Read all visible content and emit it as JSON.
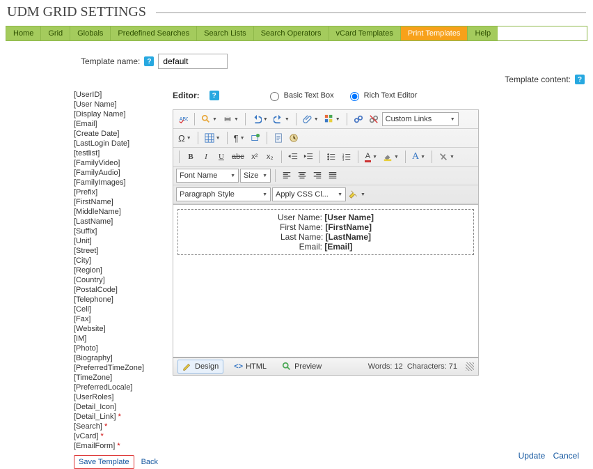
{
  "title": "UDM GRID SETTINGS",
  "tabs": [
    "Home",
    "Grid",
    "Globals",
    "Predefined Searches",
    "Search Lists",
    "Search Operators",
    "vCard Templates",
    "Print Templates",
    "Help"
  ],
  "active_tab": 7,
  "template_name_label": "Template name:",
  "template_name_value": "default",
  "template_content_label": "Template content:",
  "editor_label": "Editor:",
  "editor_modes": {
    "basic": "Basic Text Box",
    "rich": "Rich Text Editor"
  },
  "editor_mode_selected": "rich",
  "custom_links_label": "Custom Links",
  "font_name_label": "Font Name",
  "size_label": "Size",
  "paragraph_label": "Paragraph Style",
  "css_class_label": "Apply CSS Cl...",
  "fields": [
    "[UserID]",
    "[User Name]",
    "[Display Name]",
    "[Email]",
    "[Create Date]",
    "[LastLogin Date]",
    "[testlist]",
    "[FamilyVideo]",
    "[FamilyAudio]",
    "[FamilyImages]",
    "[Prefix]",
    "[FirstName]",
    "[MiddleName]",
    "[LastName]",
    "[Suffix]",
    "[Unit]",
    "[Street]",
    "[City]",
    "[Region]",
    "[Country]",
    "[PostalCode]",
    "[Telephone]",
    "[Cell]",
    "[Fax]",
    "[Website]",
    "[IM]",
    "[Photo]",
    "[Biography]",
    "[PreferredTimeZone]",
    "[TimeZone]",
    "[PreferredLocale]",
    "[UserRoles]",
    "[Detail_Icon]",
    "[Detail_Link]",
    "[Search]",
    "[vCard]",
    "[EmailForm]"
  ],
  "asterisk_fields": [
    "[Detail_Link]",
    "[Search]",
    "[vCard]",
    "[EmailForm]"
  ],
  "save_label": "Save Template",
  "back_label": "Back",
  "editor_content": [
    {
      "label": "User Name:",
      "token": "[User Name]"
    },
    {
      "label": "First Name:",
      "token": "[FirstName]"
    },
    {
      "label": "Last Name:",
      "token": "[LastName]"
    },
    {
      "label": "Email:",
      "token": "[Email]"
    }
  ],
  "view_modes": {
    "design": "Design",
    "html": "HTML",
    "preview": "Preview"
  },
  "stats_words_label": "Words:",
  "stats_words": 12,
  "stats_chars_label": "Characters:",
  "stats_chars": 71,
  "actions": {
    "update": "Update",
    "cancel": "Cancel"
  }
}
